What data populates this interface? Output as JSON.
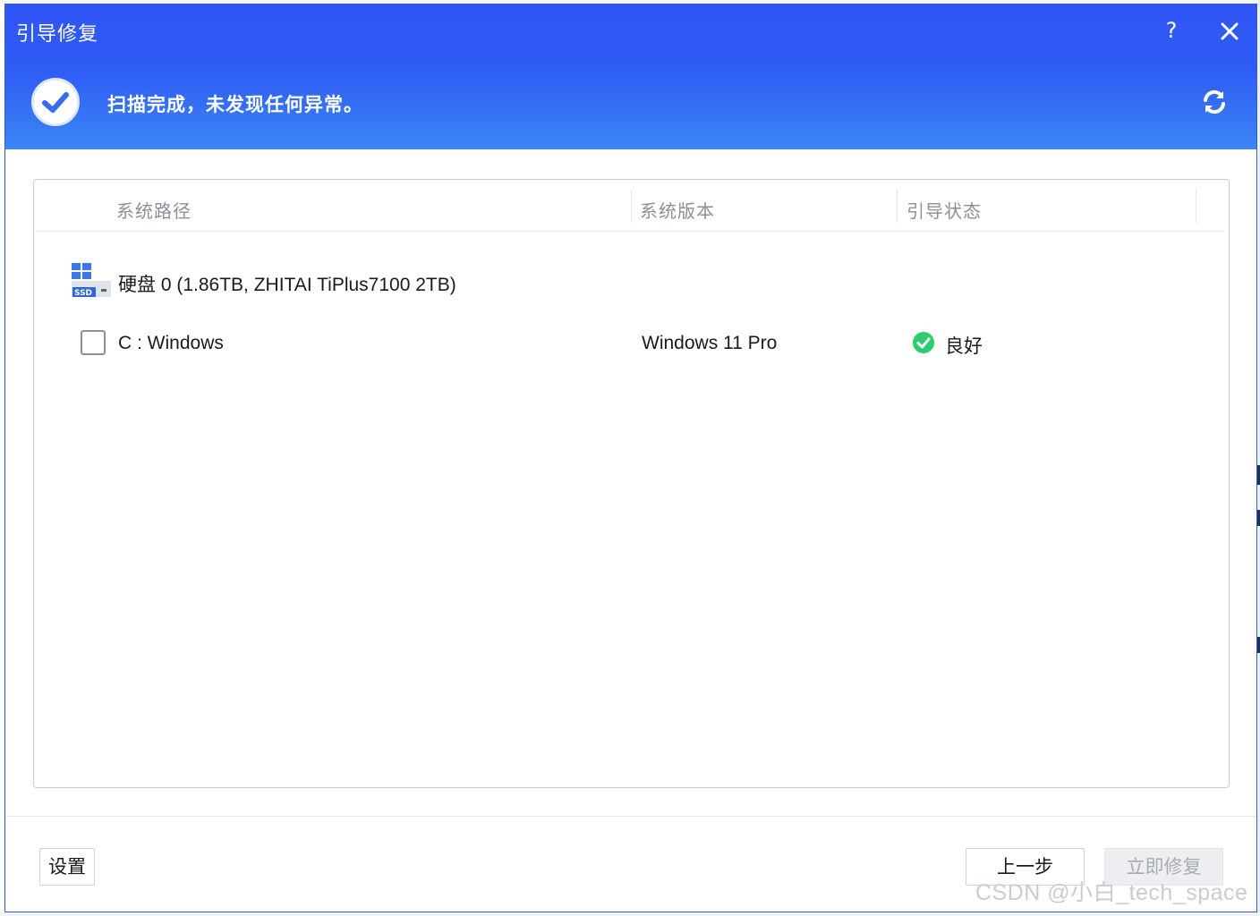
{
  "window": {
    "title": "引导修复",
    "help_label": "?"
  },
  "banner": {
    "status_text": "扫描完成，未发现任何异常。"
  },
  "table": {
    "columns": [
      "系统路径",
      "系统版本",
      "引导状态"
    ],
    "disk": {
      "label": "硬盘 0 (1.86TB, ZHITAI TiPlus7100 2TB)",
      "icon_badge": "SSD"
    },
    "partitions": [
      {
        "name": "C : Windows",
        "version": "Windows 11 Pro",
        "status": "良好",
        "checked": false
      }
    ]
  },
  "footer": {
    "settings_label": "设置",
    "back_label": "上一步",
    "repair_label": "立即修复"
  },
  "watermark": "CSDN @小白_tech_space",
  "colors": {
    "header_top": "#2f55f5",
    "header_bottom": "#3b86f5",
    "ok_green": "#2ecc71",
    "check_blue": "#3a6cf0"
  }
}
